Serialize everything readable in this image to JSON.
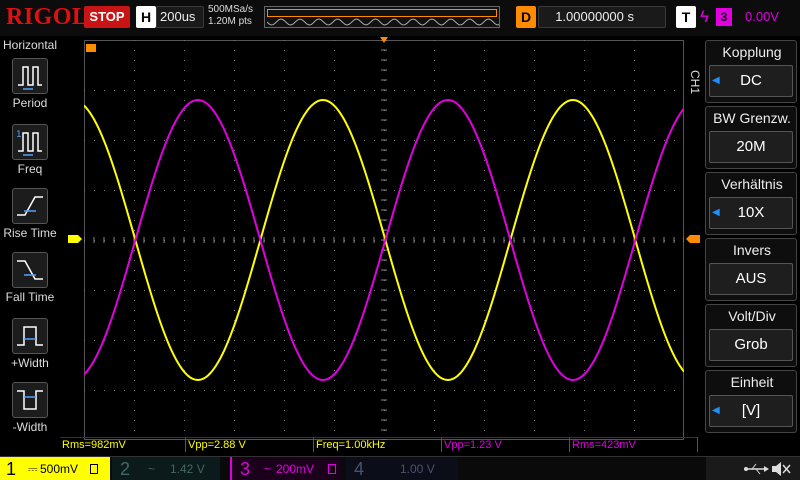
{
  "brand": "RIGOL",
  "run_state": "STOP",
  "timebase": {
    "tag": "H",
    "value": "200us"
  },
  "acquisition": {
    "sample_rate": "500MSa/s",
    "points": "1.20M pts"
  },
  "delay": {
    "tag": "D",
    "value": "1.00000000 s"
  },
  "trigger": {
    "tag": "T",
    "source": "3",
    "level": "0.00V"
  },
  "left_panel": {
    "title": "Horizontal",
    "items": [
      {
        "label": "Period",
        "icon": "period-icon"
      },
      {
        "label": "Freq",
        "icon": "frequency-icon"
      },
      {
        "label": "Rise Time",
        "icon": "rise-time-icon"
      },
      {
        "label": "Fall Time",
        "icon": "fall-time-icon"
      },
      {
        "label": "+Width",
        "icon": "positive-width-icon"
      },
      {
        "label": "-Width",
        "icon": "negative-width-icon"
      }
    ]
  },
  "measurements": [
    {
      "text": "Rms=982mV",
      "color": "#ffff00"
    },
    {
      "text": "Vpp=2.88 V",
      "color": "#ffff00"
    },
    {
      "text": "Freq=1.00kHz",
      "color": "#ffff00"
    },
    {
      "text": "Vpp=1.23 V",
      "color": "#e000e0"
    },
    {
      "text": "Rms=423mV",
      "color": "#e000e0"
    }
  ],
  "right_menu": {
    "channel": "CH1",
    "items": [
      {
        "title": "Kopplung",
        "value": "DC"
      },
      {
        "title": "BW Grenzw.",
        "value": "20M"
      },
      {
        "title": "Verhältnis",
        "value": "10X"
      },
      {
        "title": "Invers",
        "value": "AUS"
      },
      {
        "title": "Volt/Div",
        "value": "Grob"
      },
      {
        "title": "Einheit",
        "value": "[V]"
      }
    ]
  },
  "channels": [
    {
      "num": "1",
      "scale": "500mV",
      "coupling": "⎓",
      "color": "#ffff00"
    },
    {
      "num": "2",
      "scale": "1.42 V",
      "coupling": "~",
      "color": "#2a5a5a"
    },
    {
      "num": "3",
      "scale": "200mV",
      "coupling": "~",
      "color": "#e000e0"
    },
    {
      "num": "4",
      "scale": "1.00 V",
      "coupling": "",
      "color": "#333b5a"
    }
  ],
  "colors": {
    "ch1": "#ffff00",
    "ch3": "#e000e0",
    "trigger": "#ff8c00",
    "brand": "#e01010"
  },
  "chart_data": {
    "type": "line",
    "series": [
      {
        "color": "#ffff00",
        "phase": "cos",
        "frequency_khz": 1.0,
        "vpp_v": 2.88
      },
      {
        "color": "#e000e0",
        "phase": "-cos",
        "frequency_khz": 1.0,
        "vpp_v": 1.23
      }
    ],
    "grid": true,
    "divisions": [
      12,
      8
    ],
    "time_per_div_us": 200
  }
}
